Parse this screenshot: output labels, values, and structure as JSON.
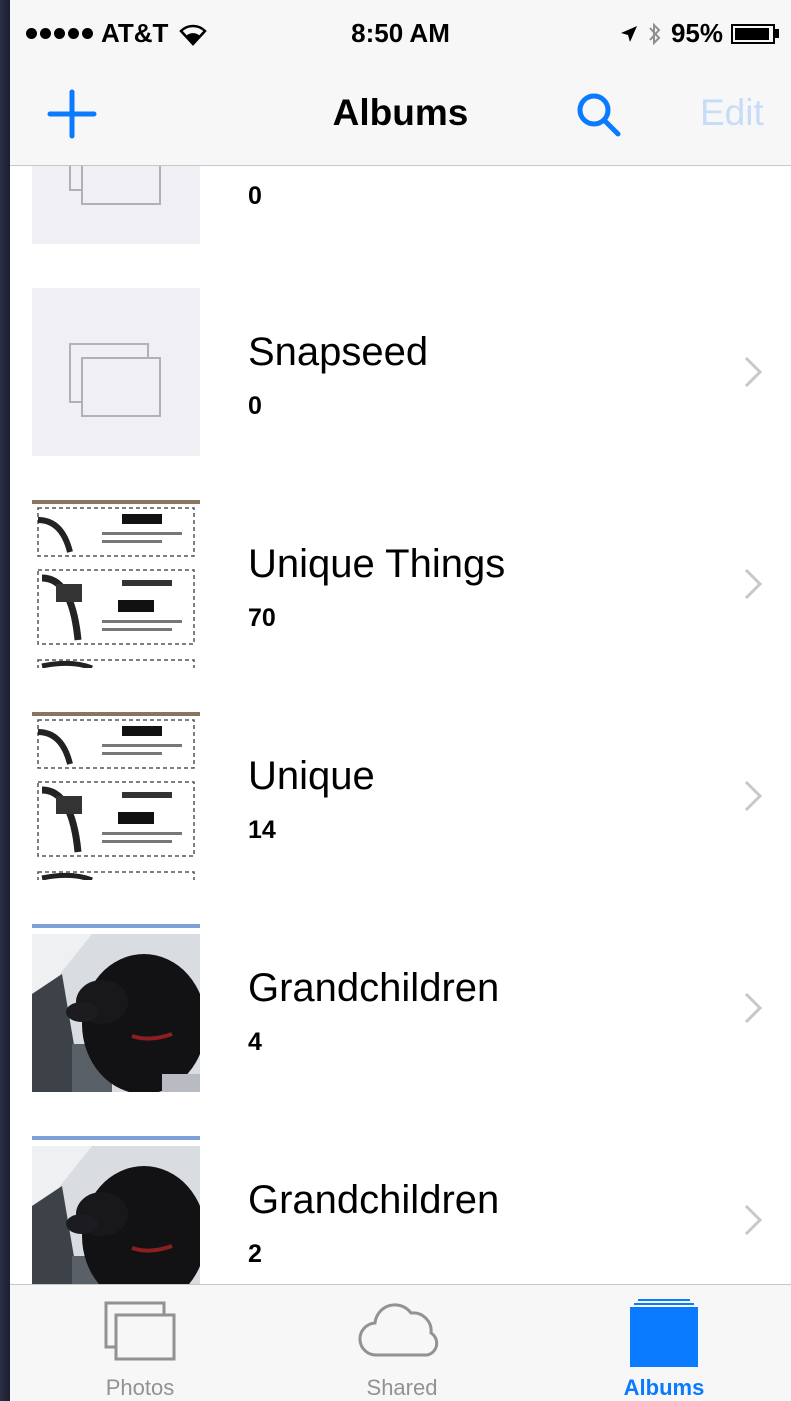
{
  "status_bar": {
    "carrier": "AT&T",
    "time": "8:50 AM",
    "battery": "95%"
  },
  "nav": {
    "title": "Albums",
    "edit_label": "Edit"
  },
  "albums": [
    {
      "title": "",
      "count": "0",
      "thumb": "placeholder-icon"
    },
    {
      "title": "Snapseed",
      "count": "0",
      "thumb": "placeholder-icon"
    },
    {
      "title": "Unique Things",
      "count": "70",
      "thumb": "coupon-photo"
    },
    {
      "title": "Unique",
      "count": "14",
      "thumb": "coupon-photo"
    },
    {
      "title": "Grandchildren",
      "count": "4",
      "thumb": "dog-photo"
    },
    {
      "title": "Grandchildren",
      "count": "2",
      "thumb": "dog-photo"
    }
  ],
  "tab_bar": {
    "tabs": [
      {
        "label": "Photos",
        "icon": "photos-icon"
      },
      {
        "label": "Shared",
        "icon": "cloud-icon"
      },
      {
        "label": "Albums",
        "icon": "albums-icon"
      }
    ],
    "active": "Albums"
  },
  "colors": {
    "accent": "#0a7aff",
    "edit_disabled": "#c7dcf7",
    "bar_background": "#f7f7f7",
    "placeholder_background": "#efeff4"
  }
}
